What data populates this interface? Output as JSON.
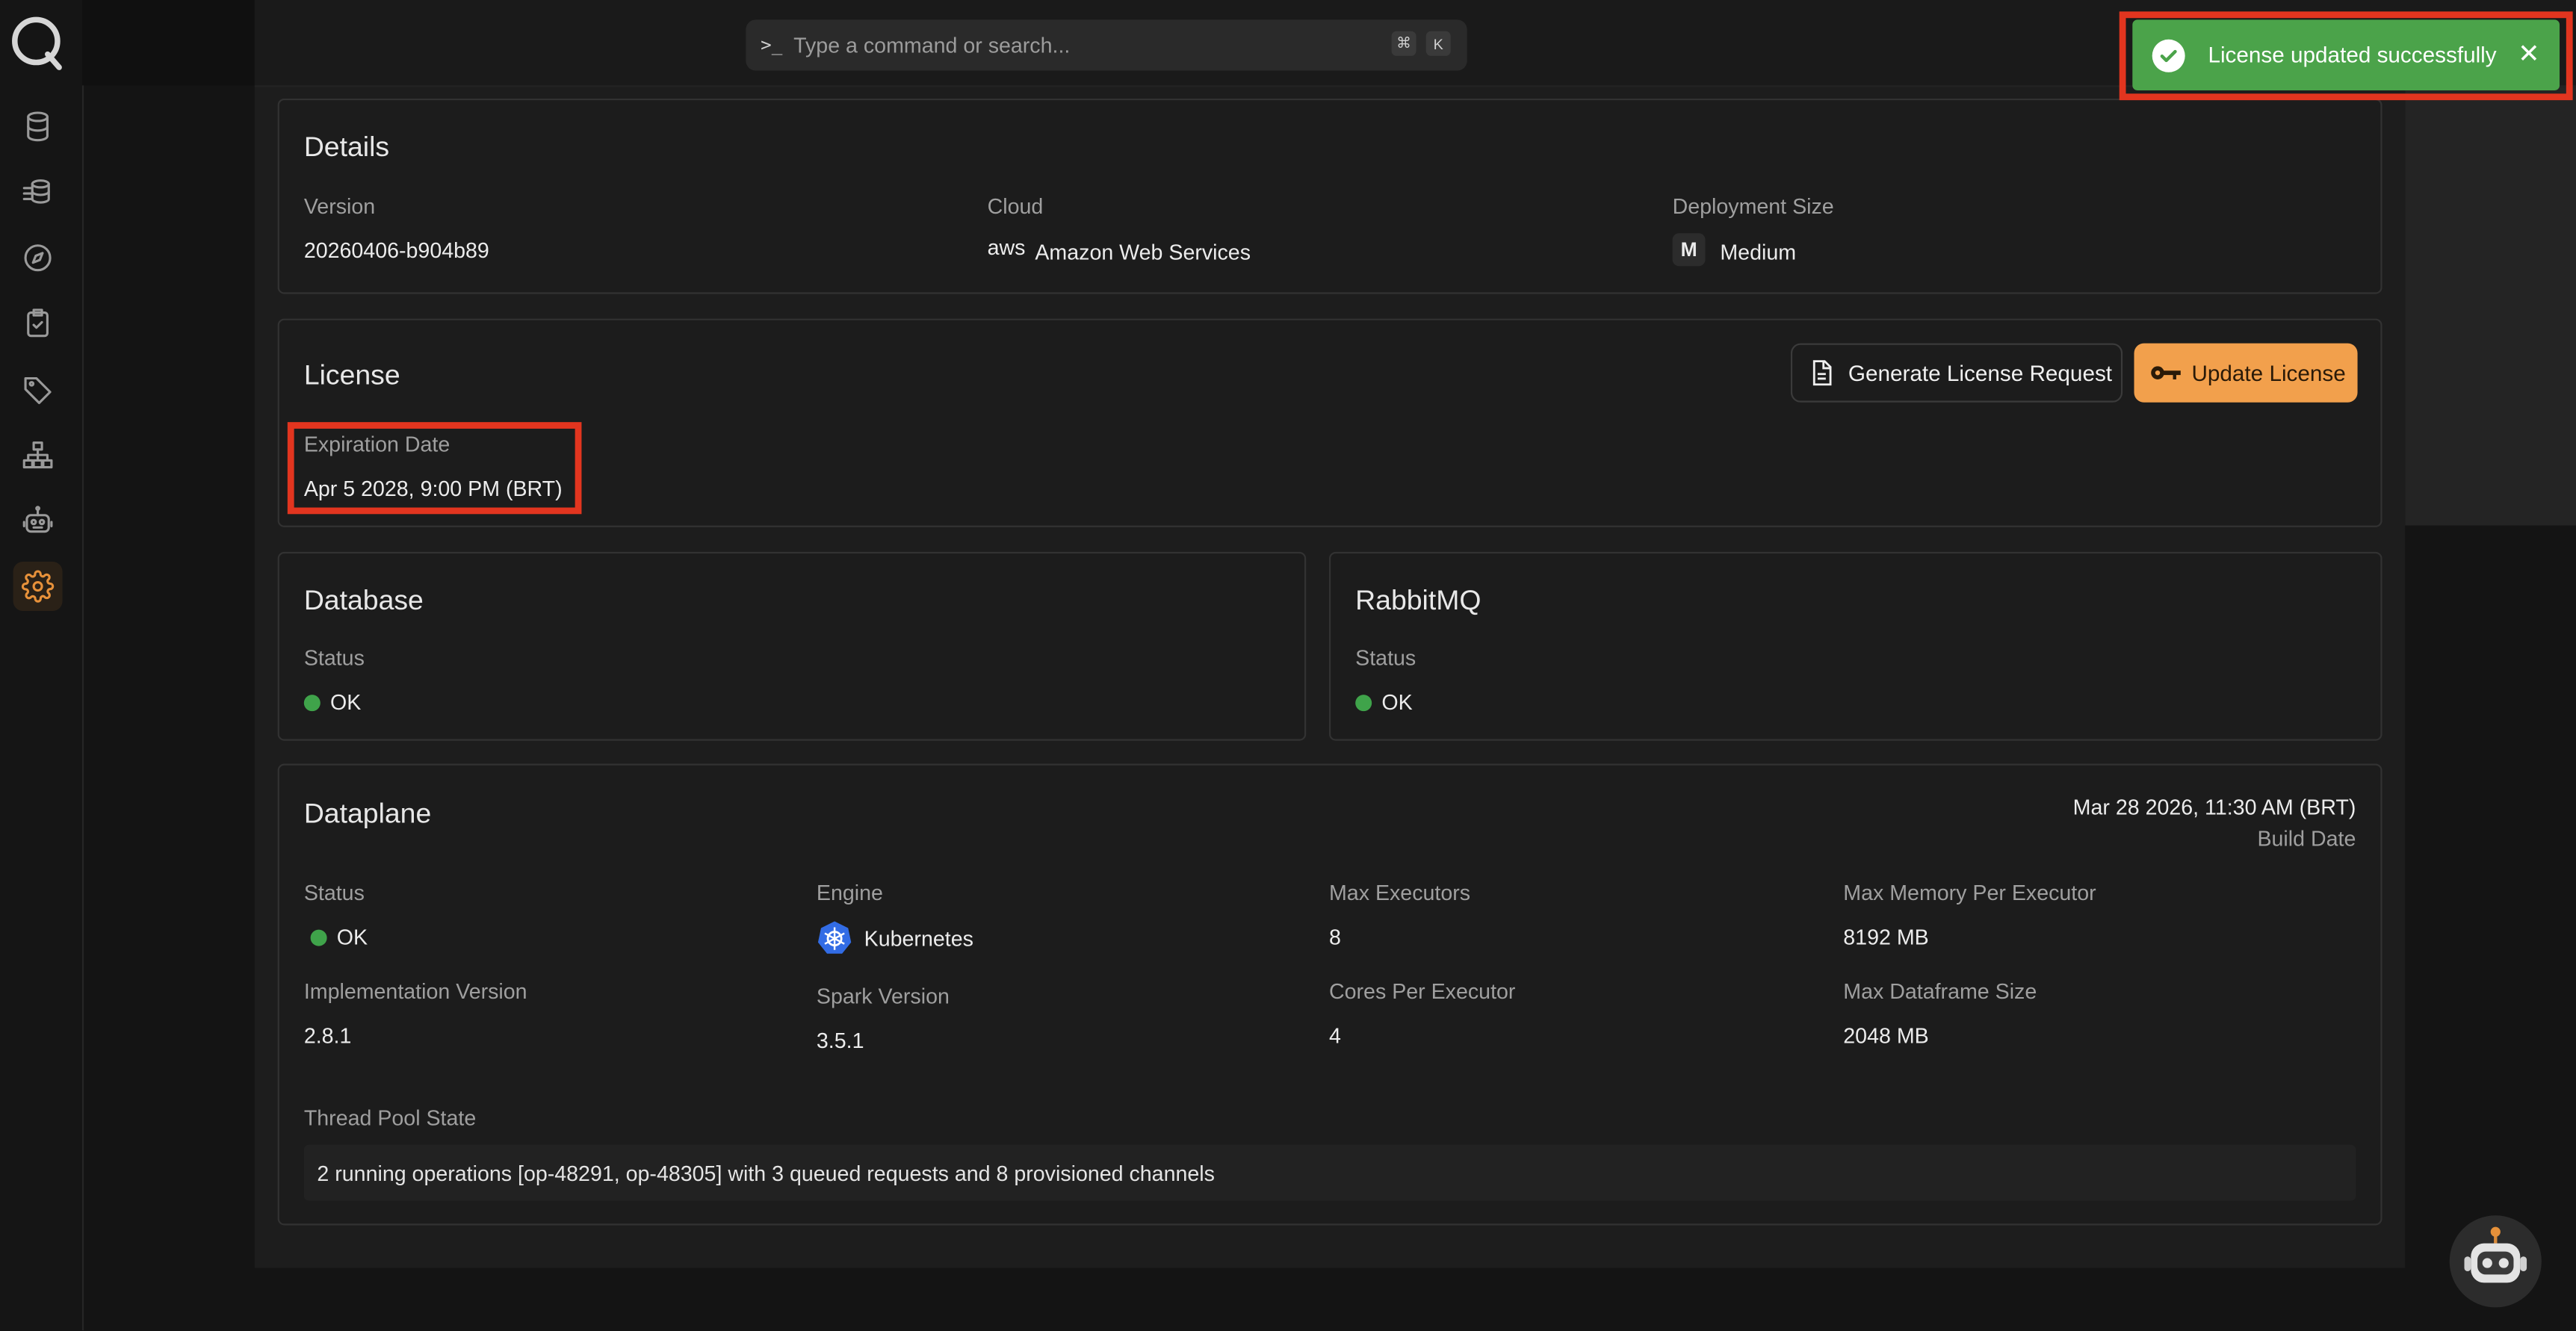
{
  "search": {
    "placeholder": "Type a command or search...",
    "prompt": ">_",
    "shortcut_mod": "⌘",
    "shortcut_key": "K"
  },
  "sidebar": {
    "items": [
      {
        "name": "database",
        "active": false
      },
      {
        "name": "datasets",
        "active": false
      },
      {
        "name": "explore",
        "active": false
      },
      {
        "name": "tasks",
        "active": false
      },
      {
        "name": "tags",
        "active": false
      },
      {
        "name": "hierarchy",
        "active": false
      },
      {
        "name": "bot",
        "active": false
      },
      {
        "name": "settings",
        "active": true
      }
    ]
  },
  "details": {
    "title": "Details",
    "version_label": "Version",
    "version": "20260406-b904b89",
    "cloud_label": "Cloud",
    "cloud": "Amazon Web Services",
    "cloud_logo": "aws",
    "size_label": "Deployment Size",
    "size": "Medium",
    "size_icon": "M"
  },
  "license": {
    "title": "License",
    "generate_label": "Generate License Request",
    "update_label": "Update License",
    "expiration_label": "Expiration Date",
    "expiration": "Apr 5 2028, 9:00 PM (BRT)"
  },
  "database": {
    "title": "Database",
    "status_label": "Status",
    "status": "OK"
  },
  "rabbitmq": {
    "title": "RabbitMQ",
    "status_label": "Status",
    "status": "OK"
  },
  "dataplane": {
    "title": "Dataplane",
    "build_date": "Mar 28 2026, 11:30 AM (BRT)",
    "build_date_label": "Build Date",
    "status_label": "Status",
    "status": "OK",
    "impl_label": "Implementation Version",
    "impl": "2.8.1",
    "engine_label": "Engine",
    "engine": "Kubernetes",
    "spark_label": "Spark Version",
    "spark": "3.5.1",
    "max_exec_label": "Max Executors",
    "max_exec": "8",
    "cores_label": "Cores Per Executor",
    "cores": "4",
    "max_mem_label": "Max Memory Per Executor",
    "max_mem": "8192 MB",
    "max_df_label": "Max Dataframe Size",
    "max_df": "2048 MB",
    "thread_label": "Thread Pool State",
    "thread": "2 running operations [op-48291, op-48305] with 3 queued requests and 8 provisioned channels"
  },
  "toast": {
    "message": "License updated successfully",
    "close": "✕"
  },
  "colors": {
    "accent": "#f2a04c",
    "success": "#4ba34a",
    "highlight": "#e2351f",
    "status_ok": "#3fa34a"
  }
}
